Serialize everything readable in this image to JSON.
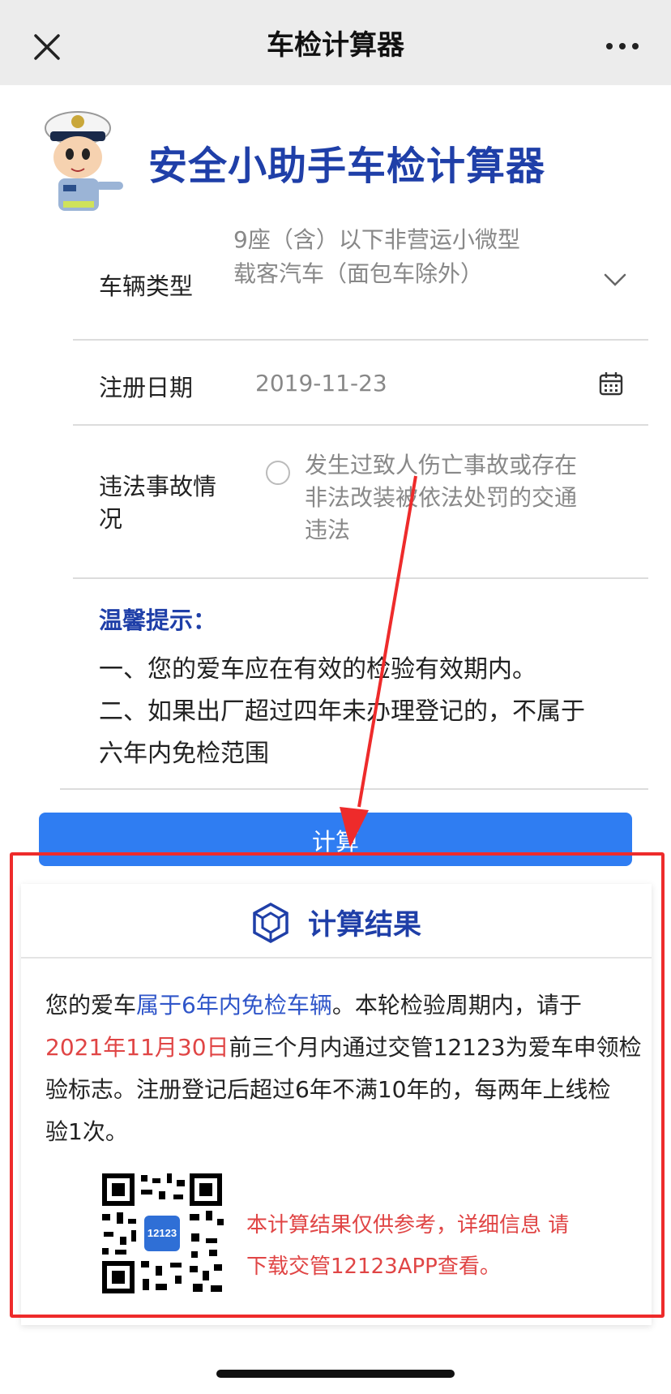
{
  "nav": {
    "title": "车检计算器",
    "close_icon": "close-icon",
    "more_icon": "more-dots-icon"
  },
  "header": {
    "app_title": "安全小助手车检计算器",
    "mascot": "traffic-police-mascot"
  },
  "form": {
    "vehicle_type": {
      "label": "车辆类型",
      "value_line1": "9座（含）以下非营运小微型",
      "value_line2": "载客汽车（面包车除外）"
    },
    "register_date": {
      "label": "注册日期",
      "value": "2019-11-23"
    },
    "violation": {
      "label_line1": "违法事故情",
      "label_line2": "况",
      "option_line1": "发生过致人伤亡事故或存在",
      "option_line2": "非法改装被依法处罚的交通",
      "option_line3": "违法",
      "checked": false
    }
  },
  "tips": {
    "title": "温馨提示：",
    "line1": "一、您的爱车应在有效的检验有效期内。",
    "line2": "二、如果出厂超过四年未办理登记的，不属于",
    "line3": "六年内免检范围"
  },
  "calculate_button": {
    "label": "计算"
  },
  "result": {
    "title": "计算结果",
    "p1_prefix": "您的爱车",
    "p1_highlight": "属于6年内免检车辆",
    "p1_suffix": "。本轮检验周期内，请于",
    "p2_date": "2021年11月30日",
    "p2_suffix": "前三个月内通过交管12123为爱车申领检",
    "p3": "验标志。注册登记后超过6年不满10年的，每两年上线检",
    "p4": "验1次。",
    "qr_logo_text": "12123",
    "disclaimer_line1": "本计算结果仅供参考，详细信息 请",
    "disclaimer_line2": "下载交管12123APP查看。"
  },
  "colors": {
    "accent_blue": "#1f3fa8",
    "button_blue": "#2f7df2",
    "highlight_red": "#e04545",
    "annotation_red": "#ee2b2b"
  }
}
